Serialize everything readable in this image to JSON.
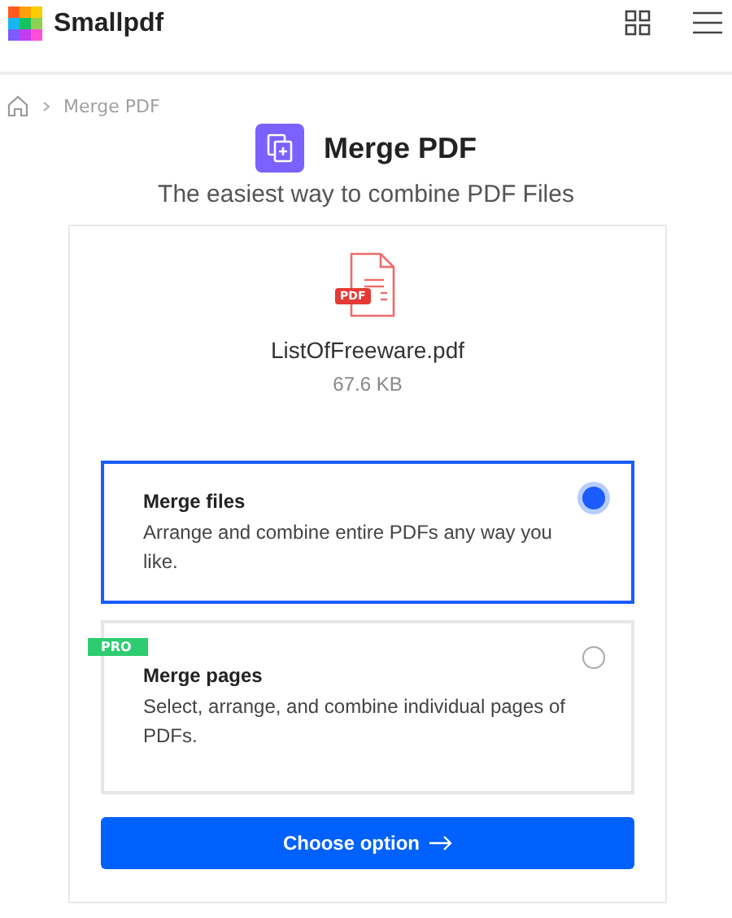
{
  "header": {
    "brand": "Smallpdf"
  },
  "breadcrumb": {
    "current": "Merge PDF"
  },
  "tool": {
    "title": "Merge PDF",
    "subtitle": "The easiest way to combine PDF Files"
  },
  "file": {
    "badge": "PDF",
    "name": "ListOfFreeware.pdf",
    "size": "67.6 KB"
  },
  "options": [
    {
      "title": "Merge files",
      "description": "Arrange and combine entire PDFs any way you like.",
      "selected": true
    },
    {
      "title": "Merge pages",
      "description": "Select, arrange, and combine individual pages of PDFs.",
      "selected": false,
      "badge": "PRO"
    }
  ],
  "action": {
    "label": "Choose option"
  }
}
